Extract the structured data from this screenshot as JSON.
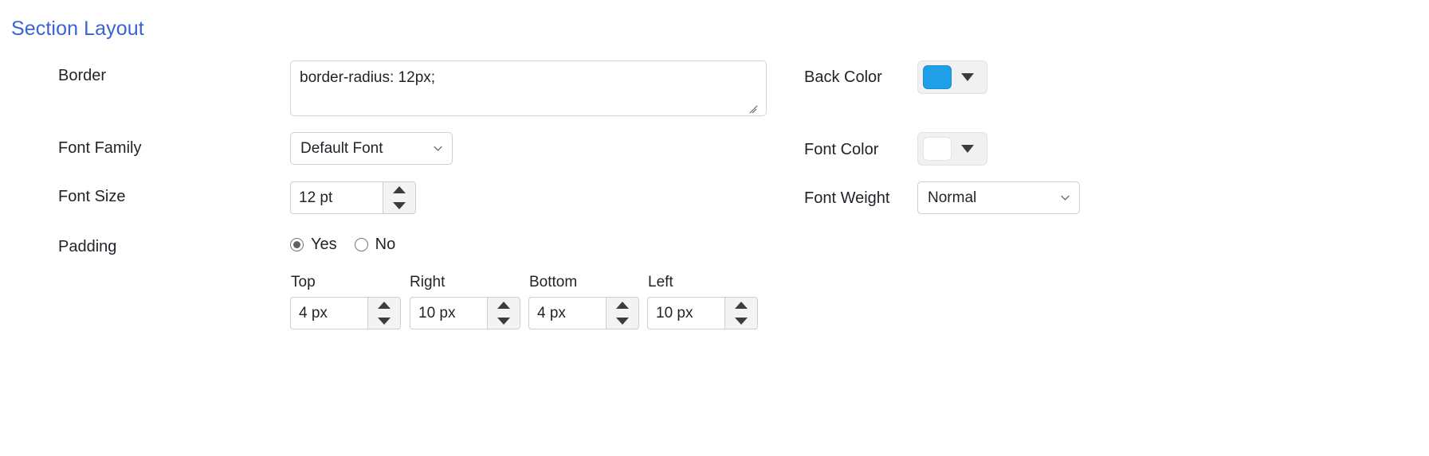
{
  "section": {
    "title": "Section Layout"
  },
  "left_column": {
    "border": {
      "label": "Border",
      "value": "border-radius: 12px;",
      "placeholder": ""
    },
    "font_family": {
      "label": "Font Family",
      "selected": "Default Font",
      "options": [
        "Default Font"
      ]
    },
    "font_size": {
      "label": "Font Size",
      "value": "12 pt"
    },
    "padding": {
      "label": "Padding",
      "options": [
        {
          "label": "Yes",
          "checked": true
        },
        {
          "label": "No",
          "checked": false
        }
      ],
      "fields": [
        {
          "caption": "Top",
          "value": "4 px"
        },
        {
          "caption": "Right",
          "value": "10 px"
        },
        {
          "caption": "Bottom",
          "value": "4 px"
        },
        {
          "caption": "Left",
          "value": "10 px"
        }
      ]
    }
  },
  "right_column": {
    "back_color": {
      "label": "Back Color",
      "value": "#1E9FE8"
    },
    "font_color": {
      "label": "Font Color",
      "value": "#FFFFFF"
    },
    "font_weight": {
      "label": "Font Weight",
      "selected": "Normal",
      "options": [
        "Normal"
      ]
    }
  },
  "icons": {
    "chevron_down": "chevron-down-icon",
    "spinner_up": "triangle-up-icon",
    "spinner_down": "triangle-down-icon",
    "color_caret": "caret-down-icon",
    "resize_grip": "resize-grip-icon"
  },
  "theme": {
    "heading_color": "#3B62D1",
    "text_color": "#1F2328",
    "border_color": "#CFCFCF",
    "control_bg": "#F1F1F1"
  }
}
